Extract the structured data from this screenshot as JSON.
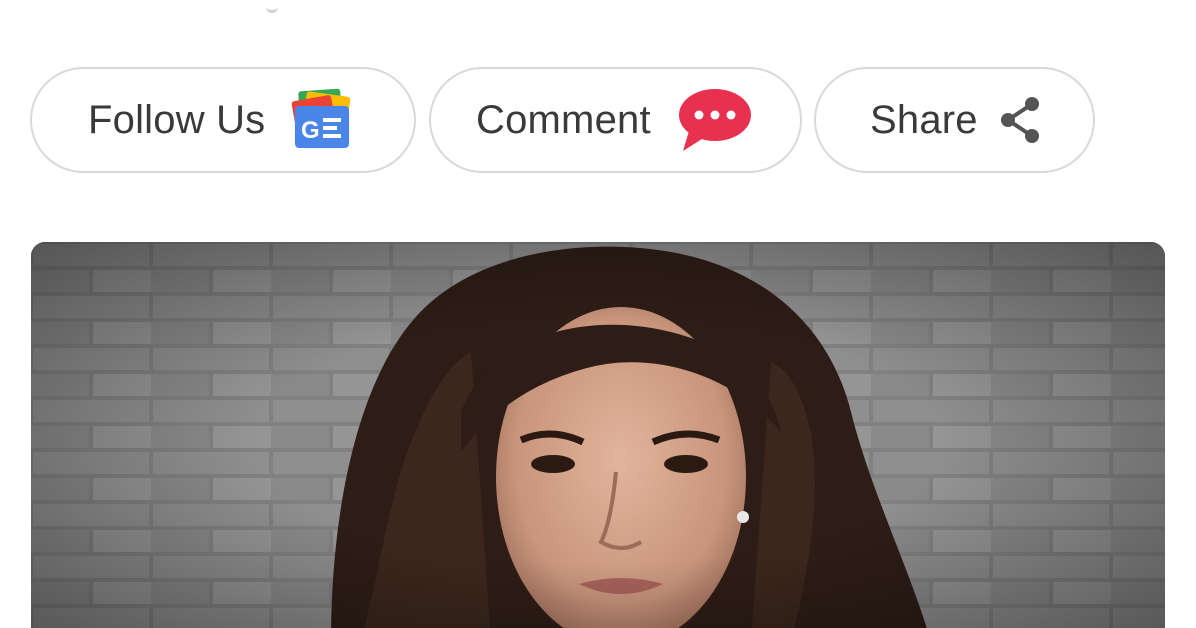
{
  "actions": {
    "follow": {
      "label": "Follow Us",
      "icon": "google-news-icon"
    },
    "comment": {
      "label": "Comment",
      "icon": "chat-bubble-icon"
    },
    "share": {
      "label": "Share",
      "icon": "share-icon"
    }
  },
  "colors": {
    "pill_border": "#d9d9d9",
    "label_text": "#3a3a3a",
    "comment_bubble": "#e8304f",
    "share_icon": "#555555",
    "gnews_blue": "#4a86e8",
    "gnews_green": "#34a853",
    "gnews_yellow": "#fbbc05",
    "gnews_red": "#ea4335"
  },
  "article_image": {
    "content": "portrait photo of a woman against a grey brick wall"
  }
}
